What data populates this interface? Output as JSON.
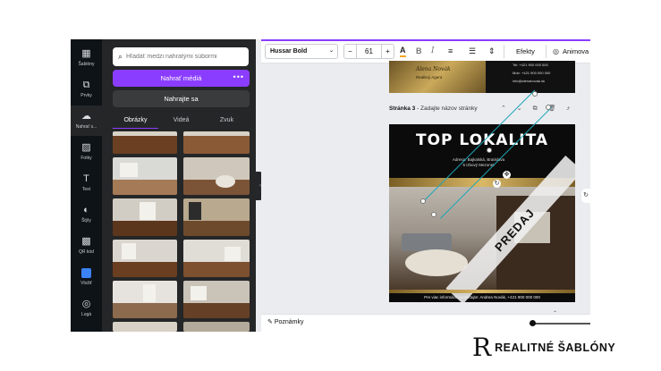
{
  "rail": {
    "items": [
      {
        "icon": "▦",
        "label": "Šablóny"
      },
      {
        "icon": "⧉",
        "label": "Prvky"
      },
      {
        "icon": "☁",
        "label": "Nahrať s..."
      },
      {
        "icon": "▨",
        "label": "Fotky"
      },
      {
        "icon": "T",
        "label": "Text"
      },
      {
        "icon": "◐",
        "label": "Štýly"
      },
      {
        "icon": "▩",
        "label": "QR kód"
      },
      {
        "icon": "■",
        "label": "Vložiť"
      },
      {
        "icon": "◎",
        "label": "Logá"
      }
    ]
  },
  "panel": {
    "search_placeholder": "Hľadať medzi nahratými súbormi",
    "upload_label": "Nahrať médiá",
    "upload_more": "•••",
    "record_label": "Nahrajte sa",
    "tabs": [
      "Obrázky",
      "Videá",
      "Zvuk"
    ],
    "collapse_icon": "‹"
  },
  "toolbar": {
    "font": "Hussar Bold",
    "font_chevron": "⌄",
    "size_minus": "−",
    "size": "61",
    "size_plus": "+",
    "text_color_icon": "A",
    "bold_icon": "B",
    "italic_icon": "I",
    "align_icon": "≡",
    "list_icon": "☰",
    "spacing_icon": "⇕",
    "effects_label": "Efekty",
    "animate_label": "Animova"
  },
  "page2": {
    "agent_name": "Alena Novák",
    "agent_title": "Realitný Agent",
    "phone": "Tel: +421 900 000 000",
    "mob": "Mob: +421 900 000 000",
    "email": "info@alenanovak.sk"
  },
  "page3": {
    "header_prefix": "Stránka 3",
    "header_suffix": " - Zadajte názov stránky",
    "controls": "⌃ ⌄ ⧉ 🗑 ⤴",
    "title": "TOP LOKALITA",
    "address_line1": "Adresa: Bajkalská, Bratislava",
    "address_line2": "5 izbový Mezonet",
    "ribbon": "PREDAJ",
    "footer": "Pre viac informácií kontaktujte: Andrea Novák, +421 900 000 000",
    "rotate_icon": "↻",
    "move_icon": "✥"
  },
  "canvas": {
    "side_icon": "↻",
    "up_icon": "⌃"
  },
  "bottom": {
    "notes_icon": "✎",
    "notes_label": "Poznámky"
  },
  "brand": {
    "mark": "R",
    "name": "REALITNÉ ŠABLÓNY"
  }
}
